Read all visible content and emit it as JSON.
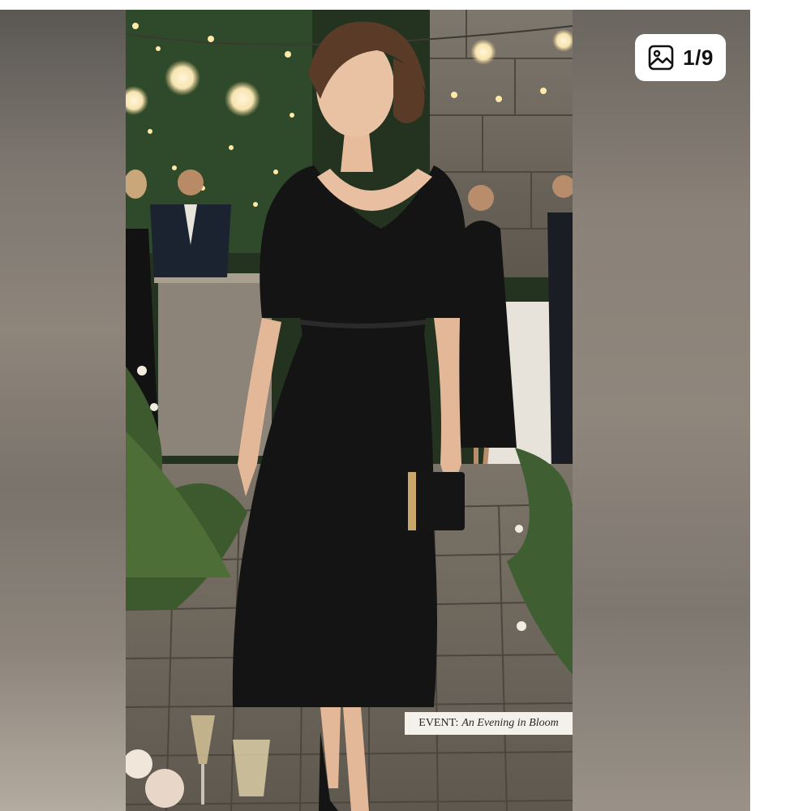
{
  "viewer": {
    "counter": "1/9",
    "counter_icon": "image-gallery-icon",
    "caption": {
      "prefix": "EVENT:",
      "title": "An Evening in Bloom"
    }
  },
  "colors": {
    "dress": "#141414",
    "background_blur": "#7a736b",
    "pill_background": "#ffffff"
  }
}
